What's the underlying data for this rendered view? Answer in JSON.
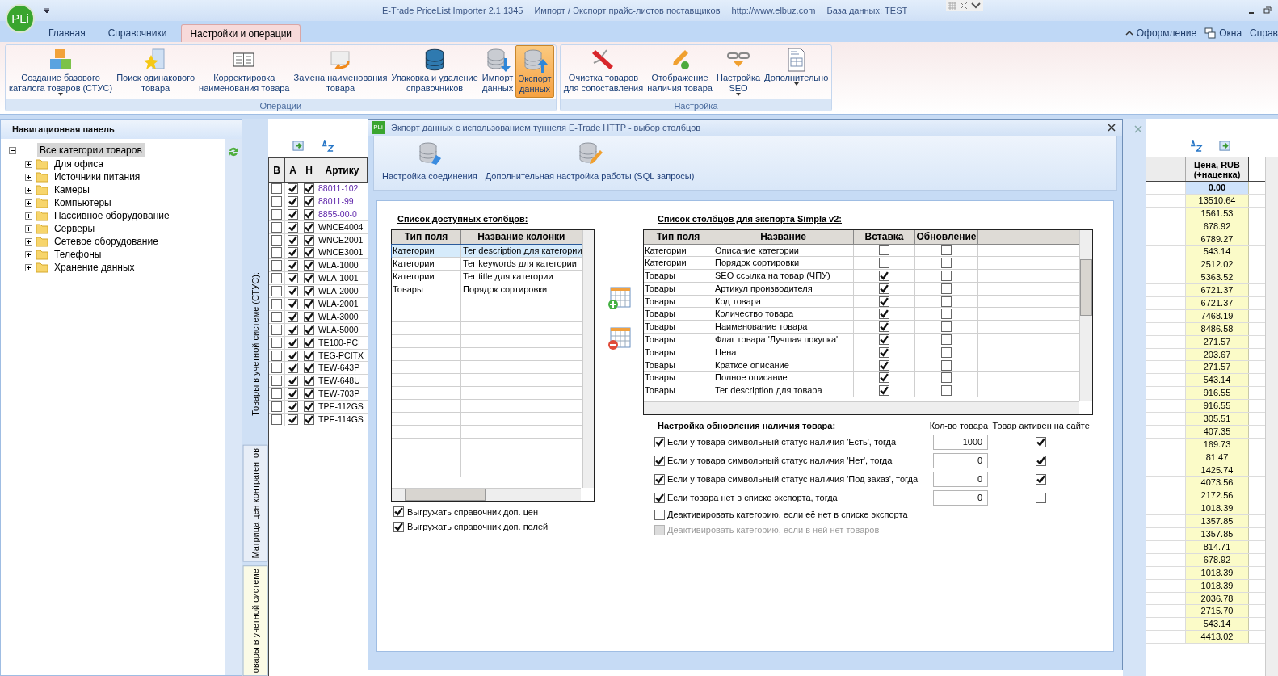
{
  "titlebar": {
    "texts": [
      "E-Trade PriceList Importer 2.1.1345",
      "Импорт / Экспорт прайс-листов поставщиков",
      "http://www.elbuz.com",
      "База данных: TEST"
    ],
    "logo": "PLi"
  },
  "tabs": [
    {
      "label": "Главная",
      "selected": false
    },
    {
      "label": "Справочники",
      "selected": false
    },
    {
      "label": "Настройки и операции",
      "selected": true
    }
  ],
  "right_menu": [
    {
      "label": "Оформление"
    },
    {
      "label": "Окна"
    },
    {
      "label": "Справ"
    }
  ],
  "ribbon": [
    {
      "label": "Операции",
      "buttons": [
        {
          "label": "Создание базового\nкаталога товаров (СТУС)",
          "kind": "blocks",
          "dropdown": true,
          "selected": false
        },
        {
          "label": "Поиск одинакового\nтовара",
          "kind": "star-folder",
          "dropdown": false,
          "selected": false
        },
        {
          "label": "Корректировка\nнаименования товара",
          "kind": "book",
          "dropdown": false,
          "selected": false
        },
        {
          "label": "Замена наименования\nтовара",
          "kind": "envelope",
          "dropdown": false,
          "selected": false
        },
        {
          "label": "Упаковка и удаление\nсправочников",
          "kind": "database",
          "dropdown": false,
          "selected": false
        },
        {
          "label": "Импорт\nданных",
          "kind": "db-down",
          "dropdown": false,
          "selected": false
        },
        {
          "label": "Экспорт\nданных",
          "kind": "db-up",
          "dropdown": false,
          "selected": true
        }
      ]
    },
    {
      "label": "Настройка",
      "buttons": [
        {
          "label": "Очистка товаров\nдля сопоставления",
          "kind": "multitool",
          "dropdown": false,
          "selected": false
        },
        {
          "label": "Отображение\nналичия товара",
          "kind": "pencil",
          "dropdown": false,
          "selected": false
        },
        {
          "label": "Настройка\nSEO",
          "kind": "chain",
          "dropdown": true,
          "selected": false
        },
        {
          "label": "Дополнительно",
          "kind": "document",
          "dropdown": true,
          "selected": false
        }
      ]
    }
  ],
  "nav": {
    "title": "Навигационная панель",
    "tree": [
      {
        "label": "Все категории товаров",
        "selected": true,
        "expanded": true,
        "children": [
          {
            "label": "Для офиса",
            "selected": false,
            "expanded": false
          },
          {
            "label": "Источники питания",
            "selected": false,
            "expanded": false
          },
          {
            "label": "Камеры",
            "selected": false,
            "expanded": false
          },
          {
            "label": "Компьютеры",
            "selected": false,
            "expanded": false
          },
          {
            "label": "Пассивное оборудование",
            "selected": false,
            "expanded": false
          },
          {
            "label": "Серверы",
            "selected": false,
            "expanded": false
          },
          {
            "label": "Сетевое оборудование",
            "selected": false,
            "expanded": false
          },
          {
            "label": "Телефоны",
            "selected": false,
            "expanded": false
          },
          {
            "label": "Хранение данных",
            "selected": false,
            "expanded": false
          }
        ]
      }
    ]
  },
  "side_label": "Товары в учетной системе (СТУС):",
  "side_tabs": [
    {
      "label": "Матрица цен контрагентов",
      "selected": false
    },
    {
      "label": "овары в учетной системе",
      "selected": true
    }
  ],
  "products": {
    "columns": [
      "В",
      "А",
      "Н",
      "Артику"
    ],
    "rows": [
      {
        "b": false,
        "a": true,
        "h": true,
        "article": "88011-102",
        "linked": true
      },
      {
        "b": false,
        "a": true,
        "h": true,
        "article": "88011-99",
        "linked": true
      },
      {
        "b": false,
        "a": true,
        "h": true,
        "article": "8855-00-0",
        "linked": true
      },
      {
        "b": false,
        "a": true,
        "h": true,
        "article": "WNCE4004",
        "linked": false
      },
      {
        "b": false,
        "a": true,
        "h": true,
        "article": "WNCE2001",
        "linked": false
      },
      {
        "b": false,
        "a": true,
        "h": true,
        "article": "WNCE3001",
        "linked": false
      },
      {
        "b": false,
        "a": true,
        "h": true,
        "article": "WLA-1000",
        "linked": false
      },
      {
        "b": false,
        "a": true,
        "h": true,
        "article": "WLA-1001",
        "linked": false
      },
      {
        "b": false,
        "a": true,
        "h": true,
        "article": "WLA-2000",
        "linked": false
      },
      {
        "b": false,
        "a": true,
        "h": true,
        "article": "WLA-2001",
        "linked": false
      },
      {
        "b": false,
        "a": true,
        "h": true,
        "article": "WLA-3000",
        "linked": false
      },
      {
        "b": false,
        "a": true,
        "h": true,
        "article": "WLA-5000",
        "linked": false
      },
      {
        "b": false,
        "a": true,
        "h": true,
        "article": "TE100-PCI",
        "linked": false
      },
      {
        "b": false,
        "a": true,
        "h": true,
        "article": "TEG-PCITX",
        "linked": false
      },
      {
        "b": false,
        "a": true,
        "h": true,
        "article": "TEW-643P",
        "linked": false
      },
      {
        "b": false,
        "a": true,
        "h": true,
        "article": "TEW-648U",
        "linked": false
      },
      {
        "b": false,
        "a": true,
        "h": true,
        "article": "TEW-703P",
        "linked": false
      },
      {
        "b": false,
        "a": true,
        "h": true,
        "article": "TPE-112GS",
        "linked": false
      },
      {
        "b": false,
        "a": true,
        "h": true,
        "article": "TPE-114GS",
        "linked": false
      }
    ]
  },
  "prices": {
    "header": "Цена, RUB\n(+наценка)",
    "rows": [
      {
        "value": "0.00",
        "selected": true
      },
      {
        "value": "13510.64",
        "selected": false
      },
      {
        "value": "1561.53",
        "selected": false
      },
      {
        "value": "678.92",
        "selected": false
      },
      {
        "value": "6789.27",
        "selected": false
      },
      {
        "value": "543.14",
        "selected": false
      },
      {
        "value": "2512.02",
        "selected": false
      },
      {
        "value": "5363.52",
        "selected": false
      },
      {
        "value": "6721.37",
        "selected": false
      },
      {
        "value": "6721.37",
        "selected": false
      },
      {
        "value": "7468.19",
        "selected": false
      },
      {
        "value": "8486.58",
        "selected": false
      },
      {
        "value": "271.57",
        "selected": false
      },
      {
        "value": "203.67",
        "selected": false
      },
      {
        "value": "271.57",
        "selected": false
      },
      {
        "value": "543.14",
        "selected": false
      },
      {
        "value": "916.55",
        "selected": false
      },
      {
        "value": "916.55",
        "selected": false
      },
      {
        "value": "305.51",
        "selected": false
      },
      {
        "value": "407.35",
        "selected": false
      },
      {
        "value": "169.73",
        "selected": false
      },
      {
        "value": "81.47",
        "selected": false
      },
      {
        "value": "1425.74",
        "selected": false
      },
      {
        "value": "4073.56",
        "selected": false
      },
      {
        "value": "2172.56",
        "selected": false
      },
      {
        "value": "1018.39",
        "selected": false
      },
      {
        "value": "1357.85",
        "selected": false
      },
      {
        "value": "1357.85",
        "selected": false
      },
      {
        "value": "814.71",
        "selected": false
      },
      {
        "value": "678.92",
        "selected": false
      },
      {
        "value": "1018.39",
        "selected": false
      },
      {
        "value": "1018.39",
        "selected": false
      },
      {
        "value": "2036.78",
        "selected": false
      },
      {
        "value": "2715.70",
        "selected": false
      },
      {
        "value": "543.14",
        "selected": false
      },
      {
        "value": "4413.02",
        "selected": false
      }
    ]
  },
  "dialog": {
    "logo": "PLi",
    "title": "Экпорт данных с использованием туннеля E-Trade HTTP - выбор столбцов",
    "toolbar": [
      {
        "label": "Настройка соединения",
        "kind": "db-plug"
      },
      {
        "label": "Дополнительная настройка работы (SQL запросы)",
        "kind": "db-pencil"
      }
    ],
    "available": {
      "title": "Список доступных столбцов:",
      "columns": [
        "Тип поля",
        "Название колонки"
      ],
      "rows": [
        {
          "type": "Категории",
          "name": "Тег description для категории",
          "selected": true
        },
        {
          "type": "Категории",
          "name": "Тег keywords для категории",
          "selected": false
        },
        {
          "type": "Категории",
          "name": "Тег title для категории",
          "selected": false
        },
        {
          "type": "Товары",
          "name": "Порядок сортировки",
          "selected": false
        }
      ]
    },
    "options": [
      {
        "label": "Выгружать справочник доп. цен",
        "checked": true
      },
      {
        "label": "Выгружать справочник доп. полей",
        "checked": true
      }
    ],
    "export": {
      "title": "Список столбцов для экспорта Simpla v2:",
      "columns": [
        "Тип поля",
        "Название",
        "Вставка",
        "Обновление"
      ],
      "rows": [
        {
          "type": "Категории",
          "name": "Описание категории",
          "insert": false,
          "update": false
        },
        {
          "type": "Категории",
          "name": "Порядок сортировки",
          "insert": false,
          "update": false
        },
        {
          "type": "Товары",
          "name": "SEO ссылка на товар (ЧПУ)",
          "insert": true,
          "update": false
        },
        {
          "type": "Товары",
          "name": "Артикул производителя",
          "insert": true,
          "update": false
        },
        {
          "type": "Товары",
          "name": "Код товара",
          "insert": true,
          "update": false
        },
        {
          "type": "Товары",
          "name": "Количество товара",
          "insert": true,
          "update": false
        },
        {
          "type": "Товары",
          "name": "Наименование товара",
          "insert": true,
          "update": false
        },
        {
          "type": "Товары",
          "name": "Флаг товара 'Лучшая покупка'",
          "insert": true,
          "update": false
        },
        {
          "type": "Товары",
          "name": "Цена",
          "insert": true,
          "update": false
        },
        {
          "type": "Товары",
          "name": "Краткое описание",
          "insert": true,
          "update": false
        },
        {
          "type": "Товары",
          "name": "Полное описание",
          "insert": true,
          "update": false
        },
        {
          "type": "Товары",
          "name": "Тег description для товара",
          "insert": true,
          "update": false
        }
      ]
    },
    "stock": {
      "title": "Настройка обновления наличия товара:",
      "qty_header": "Кол-во товара",
      "active_header": "Товар активен на сайте",
      "rows": [
        {
          "label": "Если у товара символьный статус наличия 'Есть', тогда",
          "checked": true,
          "qty": "1000",
          "active": true
        },
        {
          "label": "Если у товара символьный статус наличия 'Нет', тогда",
          "checked": true,
          "qty": "0",
          "active": true
        },
        {
          "label": "Если у товара символьный статус наличия 'Под заказ', тогда",
          "checked": true,
          "qty": "0",
          "active": true
        },
        {
          "label": "Если товара нет в списке экспорта, тогда",
          "checked": true,
          "qty": "0",
          "active": false
        }
      ],
      "extra": [
        {
          "label": "Деактивировать категорию, если её нет в списке экспорта",
          "checked": false,
          "disabled": false
        },
        {
          "label": "Деактивировать категорию, если в ней нет товаров",
          "checked": false,
          "disabled": true
        }
      ]
    }
  }
}
